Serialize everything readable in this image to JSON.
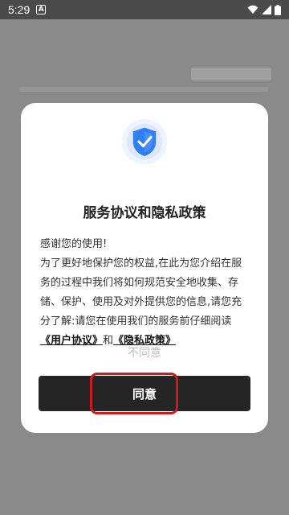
{
  "status_bar": {
    "time": "5:29",
    "app_icon_glyph": "A"
  },
  "dialog": {
    "icon": "shield-check-icon",
    "title": "服务协议和隐私政策",
    "body_intro": "感谢您的使用!",
    "body_text": "为了更好地保护您的权益,在此为您介绍在服务的过程中我们将如何规范安全地收集、存储、保护、使用及对外提供您的信息,请您充分了解:请您在使用我们的服务前仔细阅读",
    "user_agreement_link": "《用户协议》",
    "conjunction": "和",
    "privacy_policy_link": "《隐私政策》",
    "disagree_label": "不同意",
    "agree_label": "同意"
  },
  "colors": {
    "accent_blue": "#2f7ef5",
    "agree_button": "#252525",
    "highlight_red": "#c91d1d"
  }
}
